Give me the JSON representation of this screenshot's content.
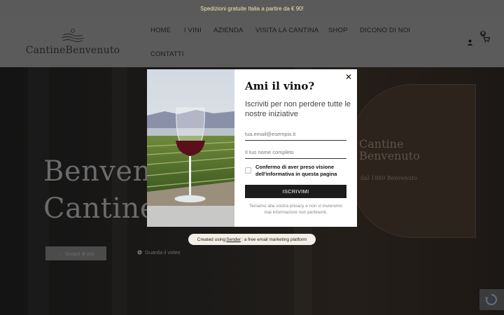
{
  "topbar": {
    "text": "Spedizioni gratuite Italia a partire da € 90!"
  },
  "header": {
    "logo_text": "CantineBenvenuto",
    "nav": [
      {
        "label": "HOME"
      },
      {
        "label": "I VINI"
      },
      {
        "label": "AZIENDA"
      },
      {
        "label": "VISITA LA CANTINA"
      },
      {
        "label": "SHOP"
      },
      {
        "label": "DICONO DI NOI"
      },
      {
        "label": "CONTATTI"
      }
    ],
    "cart_count": "0"
  },
  "hero": {
    "title_line1": "Benvenuti",
    "title_line2": "Cantine",
    "barrel_logo_line1": "Cantine",
    "barrel_logo_line2": "Benvenuto",
    "barrel_small": "dal 1880 Benvenuto",
    "cta_label": "Scopri di più",
    "video_label": "Guarda il video"
  },
  "popup": {
    "title": "Ami il vino?",
    "subtitle": "Iscriviti per non perdere tutte le nostre iniziative",
    "email_placeholder": "tua.email@esempio.it",
    "name_placeholder": "Il tuo nome completo",
    "consent_label": "Confermo di aver preso visione dell'informativa in questa pagina",
    "submit_label": "ISCRIVIMI",
    "privacy_note": "Teniamo alla vostra privacy e non vi invieremo mai informazioni non pertinenti.",
    "close_icon": "close-icon"
  },
  "sender_badge": {
    "prefix": "Created using",
    "link": "Sender",
    "suffix": ": a free email marketing platform"
  },
  "colors": {
    "popup_bg": "#ffffff",
    "submit_bg": "#1c1c1c",
    "topbar_text": "#f3e7a8",
    "badge_bg": "#f4efe6"
  }
}
